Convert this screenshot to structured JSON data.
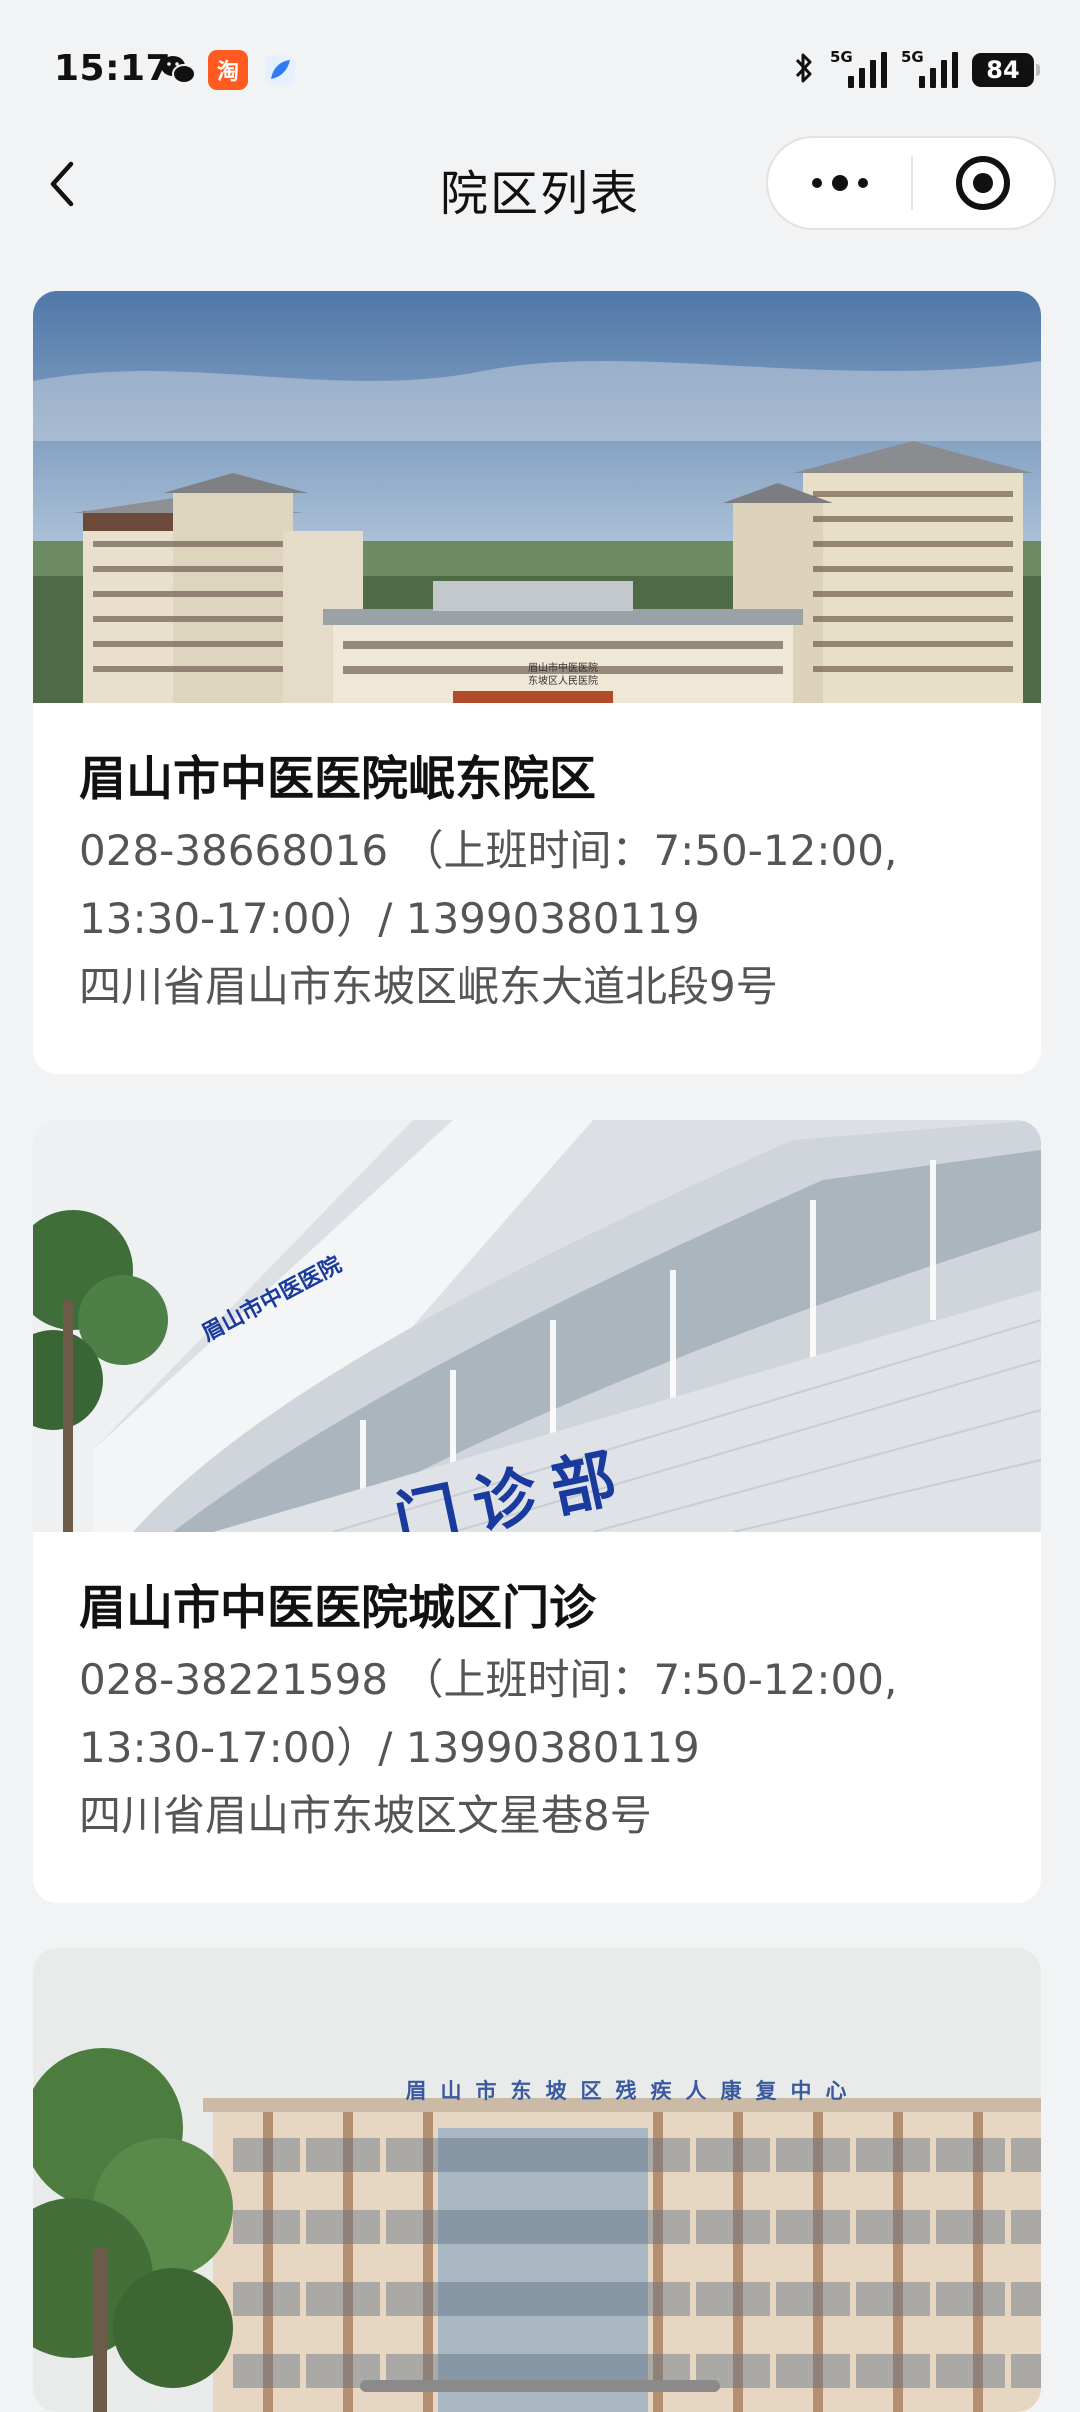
{
  "status_bar": {
    "time": "15:17",
    "app_icons": [
      "wechat-icon",
      "taobao-icon",
      "feather-icon"
    ],
    "taobao_glyph": "淘",
    "signal_1_label": "5G",
    "signal_2_label": "5G",
    "battery": "84"
  },
  "nav": {
    "title": "院区列表",
    "back_icon": "chevron-left-icon",
    "more_icon": "more-dots-icon",
    "close_icon": "target-circle-icon"
  },
  "campuses": [
    {
      "name": "眉山市中医医院岷东院区",
      "phone_line_1": "028-38668016  （上班时间：7:50-12:00,",
      "phone_line_2": "13:30-17:00）/ 13990380119",
      "address": "四川省眉山市东坡区岷东大道北段9号",
      "photo_signs": [
        "眉山市中医医院",
        "东坡区人民医院"
      ]
    },
    {
      "name": "眉山市中医医院城区门诊",
      "phone_line_1": "028-38221598  （上班时间：7:50-12:00,",
      "phone_line_2": "13:30-17:00）/ 13990380119",
      "address": "四川省眉山市东坡区文星巷8号",
      "photo_signs": [
        "眉山市中医医院",
        "门 诊 部"
      ]
    },
    {
      "name": "",
      "photo_signs": [
        "眉山市东坡区残疾人康复中心"
      ]
    }
  ],
  "colors": {
    "background": "#f2f3f5",
    "card": "#ffffff",
    "text_primary": "#111111",
    "text_secondary": "#555555",
    "sign_blue": "#1a3a9e"
  }
}
